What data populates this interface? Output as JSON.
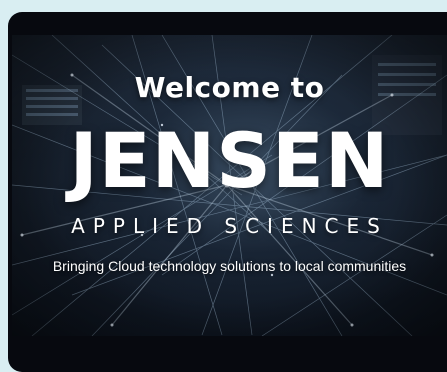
{
  "hero": {
    "welcome": "Welcome to",
    "brand": "JENSEN",
    "subtitle": "APPLIED SCIENCES",
    "tagline": "Bringing Cloud technology solutions to local communities"
  },
  "colors": {
    "page_background": "#d9eef2",
    "frame_background": "#07090f",
    "text": "#ffffff"
  }
}
